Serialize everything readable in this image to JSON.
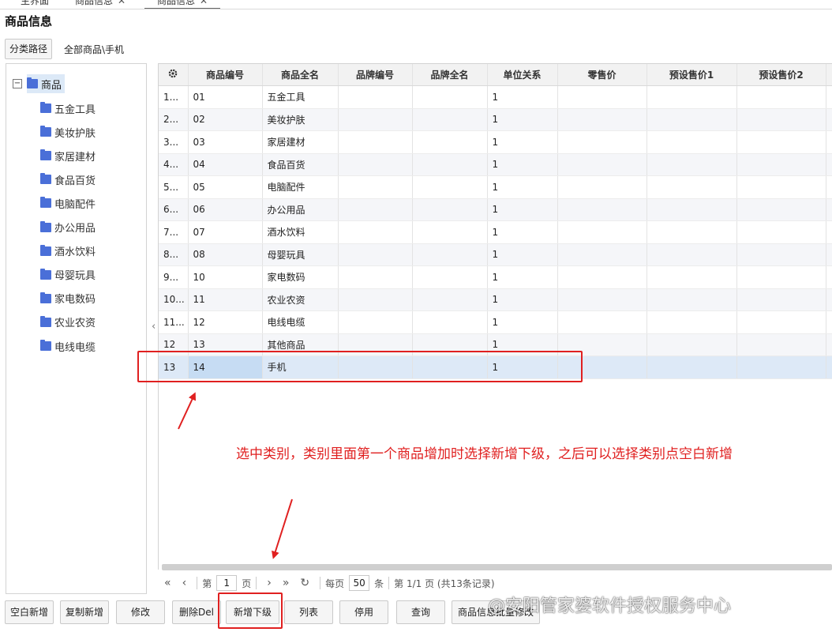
{
  "tabs": [
    {
      "label": "主界面",
      "closable": false
    },
    {
      "label": "商品信息",
      "closable": true
    },
    {
      "label": "商品信息",
      "closable": true,
      "active": true
    }
  ],
  "page_title": "商品信息",
  "path_button": "分类路径",
  "path_text": "全部商品\\手机",
  "tree": {
    "toggle": "−",
    "root": "商品",
    "items": [
      "五金工具",
      "美妆护肤",
      "家居建材",
      "食品百货",
      "电脑配件",
      "办公用品",
      "酒水饮料",
      "母婴玩具",
      "家电数码",
      "农业农资",
      "电线电缆"
    ]
  },
  "grid": {
    "settings_icon": "gear-icon",
    "columns": [
      "",
      "商品编号",
      "商品全名",
      "品牌编号",
      "品牌全名",
      "单位关系",
      "零售价",
      "预设售价1",
      "预设售价2",
      ""
    ],
    "rows": [
      {
        "idx": "1...",
        "code": "01",
        "name": "五金工具",
        "unit": "1"
      },
      {
        "idx": "2...",
        "code": "02",
        "name": "美妆护肤",
        "unit": "1"
      },
      {
        "idx": "3...",
        "code": "03",
        "name": "家居建材",
        "unit": "1"
      },
      {
        "idx": "4...",
        "code": "04",
        "name": "食品百货",
        "unit": "1"
      },
      {
        "idx": "5...",
        "code": "05",
        "name": "电脑配件",
        "unit": "1"
      },
      {
        "idx": "6...",
        "code": "06",
        "name": "办公用品",
        "unit": "1"
      },
      {
        "idx": "7...",
        "code": "07",
        "name": "酒水饮料",
        "unit": "1"
      },
      {
        "idx": "8...",
        "code": "08",
        "name": "母婴玩具",
        "unit": "1"
      },
      {
        "idx": "9...",
        "code": "10",
        "name": "家电数码",
        "unit": "1"
      },
      {
        "idx": "10...",
        "code": "11",
        "name": "农业农资",
        "unit": "1"
      },
      {
        "idx": "11...",
        "code": "12",
        "name": "电线电缆",
        "unit": "1"
      },
      {
        "idx": "12",
        "code": "13",
        "name": "其他商品",
        "unit": "1"
      },
      {
        "idx": "13",
        "code": "14",
        "name": "手机",
        "unit": "1",
        "selected": true
      }
    ]
  },
  "pager": {
    "first": "«",
    "prev": "‹",
    "page_prefix": "第",
    "page": "1",
    "page_suffix": "页",
    "next": "›",
    "last": "»",
    "refresh": "↻",
    "per_page_prefix": "每页",
    "per_page": "50",
    "per_page_suffix": "条",
    "summary": "第 1/1 页 (共13条记录)"
  },
  "buttons": [
    "空白新增",
    "复制新增",
    "修改",
    "删除Del",
    "新增下级",
    "列表",
    "停用",
    "查询",
    "商品信息批量修改"
  ],
  "annotation": "选中类别，类别里面第一个商品增加时选择新增下级，之后可以选择类别点空白新增",
  "watermark": "@安阳管家婆软件授权服务中心",
  "colors": {
    "annotation": "#e02020",
    "selected_row": "#dde9f7",
    "folder": "#4a6fd8"
  }
}
